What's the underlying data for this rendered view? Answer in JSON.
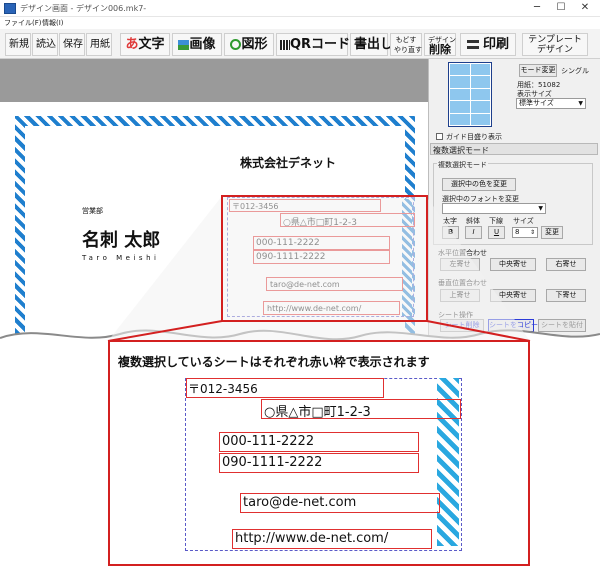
{
  "window": {
    "title": "デザイン画面 - デザイン006.mk7-",
    "minimize": "─",
    "maximize": "☐",
    "close": "✕"
  },
  "menu": [
    "ファイル(F)",
    "情報(I)"
  ],
  "toolbar": {
    "new": "新規",
    "open": "読込",
    "save": "保存",
    "paper": "用紙",
    "text_glyph": "あ",
    "text": "文字",
    "image": "画像",
    "shape": "図形",
    "qr": "QRコード",
    "write": "書出し",
    "undo_line1": "もどす",
    "undo_line2": "やり直す",
    "delete_line1": "デザイン",
    "delete_line2": "削除",
    "print": "印刷",
    "template_line1": "テンプレート",
    "template_line2": "デザイン"
  },
  "card": {
    "company": "株式会社デネット",
    "department": "営業部",
    "name": "名刺 太郎",
    "romaji": "Taro Meishi",
    "postal": "〒012-3456",
    "address": "○県△市□町1-2-3",
    "phone1": "000-111-2222",
    "phone2": "090-1111-2222",
    "email": "taro@de-net.com",
    "url": "http://www.de-net.com/"
  },
  "panel": {
    "mode_change": "モード変更",
    "mode_value": "シングル",
    "paper_label": "用紙：51082",
    "display_size_label": "表示サイズ",
    "display_size_value": "標準サイズ",
    "guide_checkbox": "ガイド目盛り表示",
    "multi_select_mode": "複数選択モード",
    "multi_select_mode_box": "複数選択モード",
    "change_color": "選択中の色を変更",
    "change_font": "選択中のフォントを変更",
    "bold_label": "太字",
    "italic_label": "斜体",
    "underline_label": "下線",
    "size_label": "サイズ",
    "bold_btn": "B",
    "italic_btn": "I",
    "underline_btn": "U",
    "size_value": "8",
    "change_btn": "変更",
    "h_align_label": "水平位置合わせ",
    "align_left": "左寄せ",
    "align_hcenter": "中央寄せ",
    "align_right": "右寄せ",
    "v_align_label": "垂直位置合わせ",
    "align_top": "上寄せ",
    "align_vcenter": "中央寄せ",
    "align_bottom": "下寄せ",
    "sheet_ops_label": "シート操作",
    "sheet_delete": "シート削除",
    "sheet_copy": "シートをコピー",
    "sheet_paste": "シートを貼付"
  },
  "callout": {
    "caption": "複数選択しているシートはそれぞれ赤い枠で表示されます"
  }
}
